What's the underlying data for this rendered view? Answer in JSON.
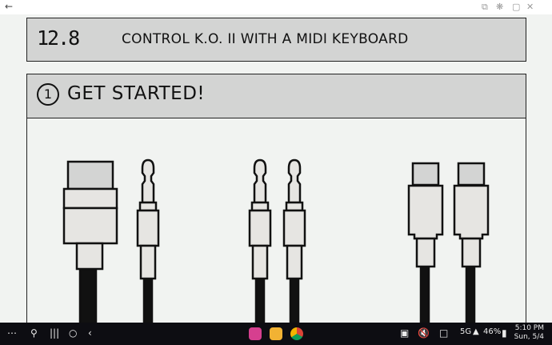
{
  "section": {
    "number": "12.8",
    "title": "CONTROL K.O. II WITH A MIDI KEYBOARD"
  },
  "step": {
    "number": "1",
    "title": "GET STARTED!"
  },
  "status": {
    "network": "5G",
    "battery": "46%",
    "time": "5:10 PM",
    "date": "Sun, 5/4"
  },
  "icons": {
    "back": "back-arrow-icon",
    "copy": "copy-icon",
    "pin": "pin-icon",
    "close": "close-icon",
    "apps": "apps-grid-icon",
    "search": "search-icon",
    "recents": "recents-icon",
    "home": "home-icon",
    "nav_back": "nav-back-icon",
    "app1": "flower-app-icon",
    "app2": "files-app-icon",
    "app3": "chrome-icon",
    "screenshot": "screenshot-icon",
    "mute": "mute-icon",
    "message": "message-icon",
    "signal": "signal-icon"
  },
  "colors": {
    "header_fill": "#d3d4d3",
    "plug_fill": "#e6e5e2",
    "nav_bg": "#0d0d12",
    "app1": "#d63f8f",
    "app2": "#f2b233"
  }
}
